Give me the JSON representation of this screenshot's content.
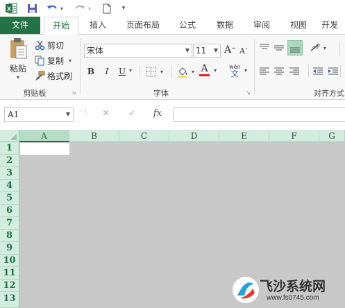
{
  "quick_access": {
    "excel_icon": "excel-logo-icon",
    "save_icon": "save-icon",
    "undo_icon": "undo-icon",
    "redo_icon": "redo-icon",
    "new_icon": "new-document-icon",
    "customize_icon": "dropdown-arrow-icon"
  },
  "tabs": [
    {
      "label": "文件"
    },
    {
      "label": "开始"
    },
    {
      "label": "插入"
    },
    {
      "label": "页面布局"
    },
    {
      "label": "公式"
    },
    {
      "label": "数据"
    },
    {
      "label": "审阅"
    },
    {
      "label": "视图"
    },
    {
      "label": "开发"
    }
  ],
  "ribbon": {
    "clipboard": {
      "paste_label": "粘贴",
      "cut_label": "剪切",
      "copy_label": "复制",
      "format_painter_label": "格式刷",
      "group_label": "剪贴板"
    },
    "font": {
      "font_name": "宋体",
      "font_size": "11",
      "bold": "B",
      "italic": "I",
      "underline": "U",
      "font_color_letter": "A",
      "phonetic_top": "wén",
      "phonetic_bottom": "文",
      "grow_letter": "A",
      "shrink_letter": "A",
      "group_label": "字体",
      "font_color_bar": "#e02020"
    },
    "alignment": {
      "group_label": "对齐方式"
    }
  },
  "formula_bar": {
    "name_box": "A1",
    "cancel_symbol": "✕",
    "enter_symbol": "✓",
    "fx_label": "fx",
    "formula": ""
  },
  "sheet": {
    "columns": [
      "A",
      "B",
      "C",
      "D",
      "E",
      "F",
      "G"
    ],
    "rows": [
      "1",
      "2",
      "3",
      "4",
      "5",
      "6",
      "7",
      "8",
      "9",
      "10",
      "11",
      "12",
      "13"
    ],
    "active_cell": "A1"
  },
  "watermark": {
    "brand": "飞沙系统网",
    "url": "www.fs0745.com"
  },
  "colors": {
    "accent": "#217346",
    "header_bg": "#d3ece0",
    "grid_bg": "#c8c8c8"
  }
}
